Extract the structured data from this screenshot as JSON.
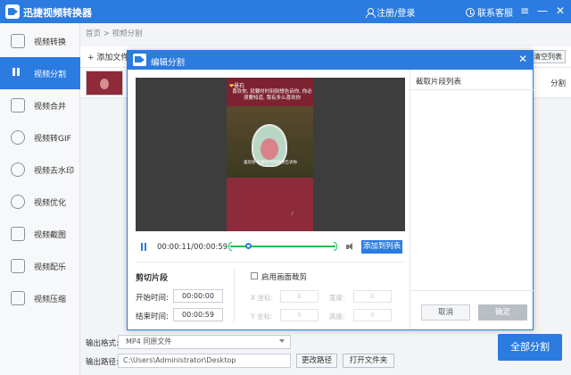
{
  "app": {
    "title": "迅捷视频转换器",
    "login": "注册/登录",
    "service": "联系客服"
  },
  "sidebar": {
    "items": [
      {
        "label": "视频转换",
        "icon": "convert-icon",
        "active": false
      },
      {
        "label": "视频分割",
        "icon": "split-icon",
        "active": true
      },
      {
        "label": "视频合并",
        "icon": "merge-icon",
        "active": false
      },
      {
        "label": "视频转GIF",
        "icon": "gif-icon",
        "active": false
      },
      {
        "label": "视频去水印",
        "icon": "watermark-icon",
        "active": false
      },
      {
        "label": "视频优化",
        "icon": "optimize-icon",
        "active": false
      },
      {
        "label": "视频截图",
        "icon": "screenshot-icon",
        "active": false
      },
      {
        "label": "视频配乐",
        "icon": "music-icon",
        "active": false
      },
      {
        "label": "视频压缩",
        "icon": "compress-icon",
        "active": false
      }
    ]
  },
  "main": {
    "breadcrumb": "首页 > 视频分割",
    "add_file": "添加文件",
    "clear_list": "清空列表",
    "file_action": "分割"
  },
  "bottom": {
    "format_label": "输出格式:",
    "format_value": "MP4  同原文件",
    "path_label": "输出路径:",
    "path_value": "C:\\Users\\Administrator\\Desktop",
    "change_path": "更改路径",
    "open_folder": "打开文件夹",
    "split_all": "全部分割"
  },
  "modal": {
    "title": "编辑分割",
    "player": {
      "time": "00:00:11/00:00:59",
      "progress": 0.19,
      "add_to_list": "添加到列表"
    },
    "video": {
      "name": "曼石",
      "caption_lines": "喜欢你, 就要时时刻刻想告诉你, 你必须要知道, 我有多么喜欢你",
      "subtitle": "喜欢你 就要时时刻刻想告诉你",
      "logo": "♪"
    },
    "cut": {
      "title": "剪切片段",
      "start_label": "开始时间:",
      "start_value": "00:00:00",
      "end_label": "结束时间:",
      "end_value": "00:00:59"
    },
    "crop": {
      "label": "启用画面裁剪",
      "x_label": "X 坐标:",
      "x_value": "0",
      "width_label": "宽度:",
      "width_value": "0",
      "y_label": "Y 坐标:",
      "y_value": "0",
      "height_label": "高度:",
      "height_value": "0"
    },
    "clip_list": {
      "title": "截取片段列表",
      "cancel": "取消",
      "ok": "确定"
    }
  },
  "colors": {
    "accent": "#2b7be0",
    "timeline": "#1ec24a",
    "video_bg": "#8e2b3b"
  }
}
